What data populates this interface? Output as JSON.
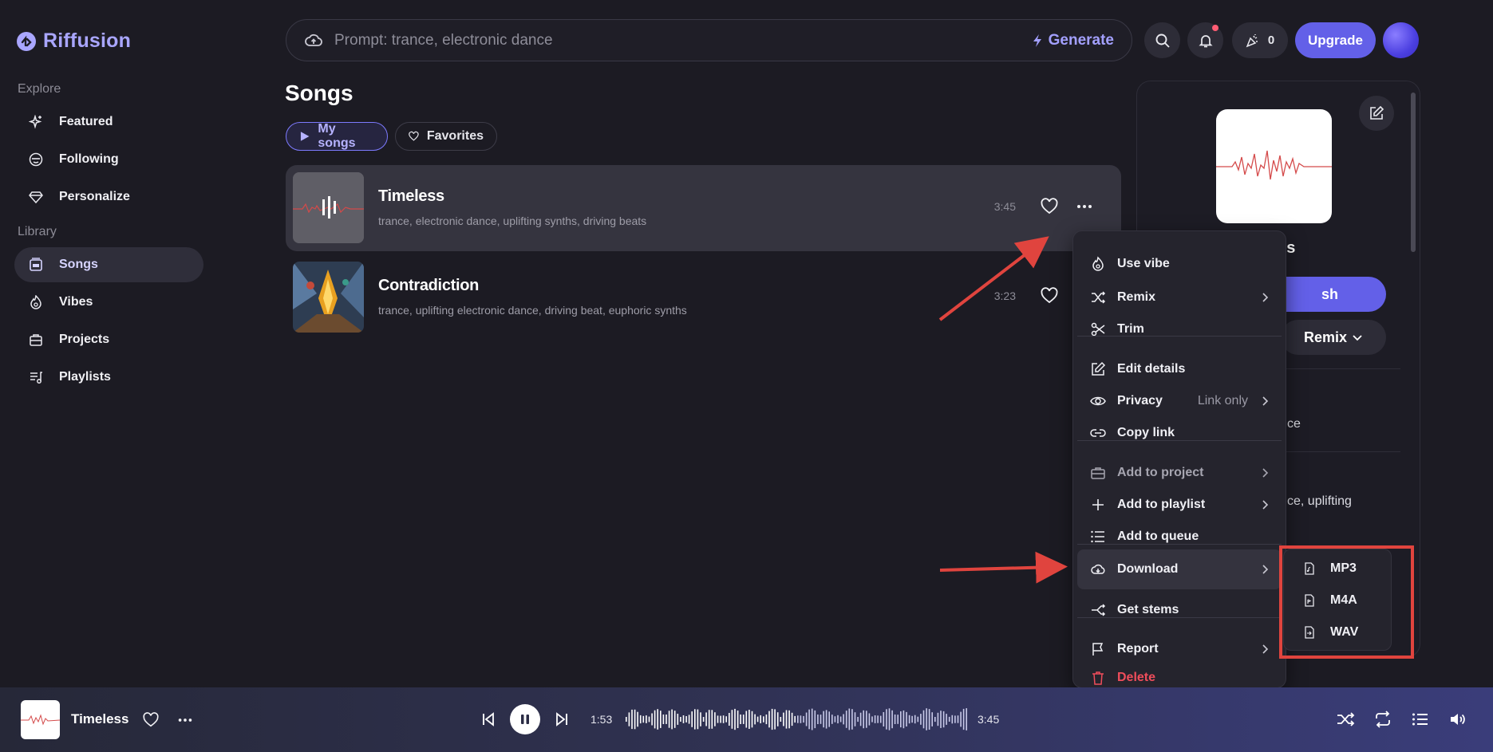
{
  "app": {
    "name": "Riffusion"
  },
  "sidebar": {
    "explore_label": "Explore",
    "library_label": "Library",
    "explore_items": [
      {
        "label": "Featured",
        "icon": "sparkle-icon"
      },
      {
        "label": "Following",
        "icon": "smile-icon"
      },
      {
        "label": "Personalize",
        "icon": "diamond-icon"
      }
    ],
    "library_items": [
      {
        "label": "Songs",
        "icon": "song-icon",
        "active": true
      },
      {
        "label": "Vibes",
        "icon": "flame-icon"
      },
      {
        "label": "Projects",
        "icon": "briefcase-icon"
      },
      {
        "label": "Playlists",
        "icon": "playlist-icon"
      }
    ]
  },
  "topbar": {
    "prompt_placeholder": "Prompt: trance, electronic dance",
    "generate_label": "Generate",
    "credits": "0",
    "upgrade_label": "Upgrade"
  },
  "main": {
    "title": "Songs",
    "tabs": [
      {
        "label": "My songs",
        "active": true
      },
      {
        "label": "Favorites",
        "active": false
      }
    ],
    "songs": [
      {
        "title": "Timeless",
        "tags": "trance, electronic dance, uplifting synths, driving beats",
        "duration": "3:45"
      },
      {
        "title": "Contradiction",
        "tags": "trance, uplifting electronic dance, driving beat, euphoric synths",
        "duration": "3:23"
      }
    ]
  },
  "right_panel": {
    "title_fragment": "ess",
    "publish_fragment": "sh",
    "remix_label": "Remix",
    "text_1": "ce",
    "text_2": "ce, uplifting"
  },
  "context_menu": {
    "items": [
      {
        "label": "Use vibe"
      },
      {
        "label": "Remix"
      },
      {
        "label": "Trim"
      },
      {
        "label": "Edit details"
      },
      {
        "label": "Privacy",
        "value": "Link only"
      },
      {
        "label": "Copy link"
      },
      {
        "label": "Add to project"
      },
      {
        "label": "Add to playlist"
      },
      {
        "label": "Add to queue"
      },
      {
        "label": "Download"
      },
      {
        "label": "Get stems"
      },
      {
        "label": "Report"
      },
      {
        "label": "Delete"
      }
    ],
    "download_options": [
      "MP3",
      "M4A",
      "WAV"
    ]
  },
  "player": {
    "title": "Timeless",
    "elapsed": "1:53",
    "total": "3:45",
    "progress": 0.5
  },
  "colors": {
    "accent": "#6360e8",
    "highlight_box": "#e0443e",
    "danger": "#ef4d5b"
  }
}
